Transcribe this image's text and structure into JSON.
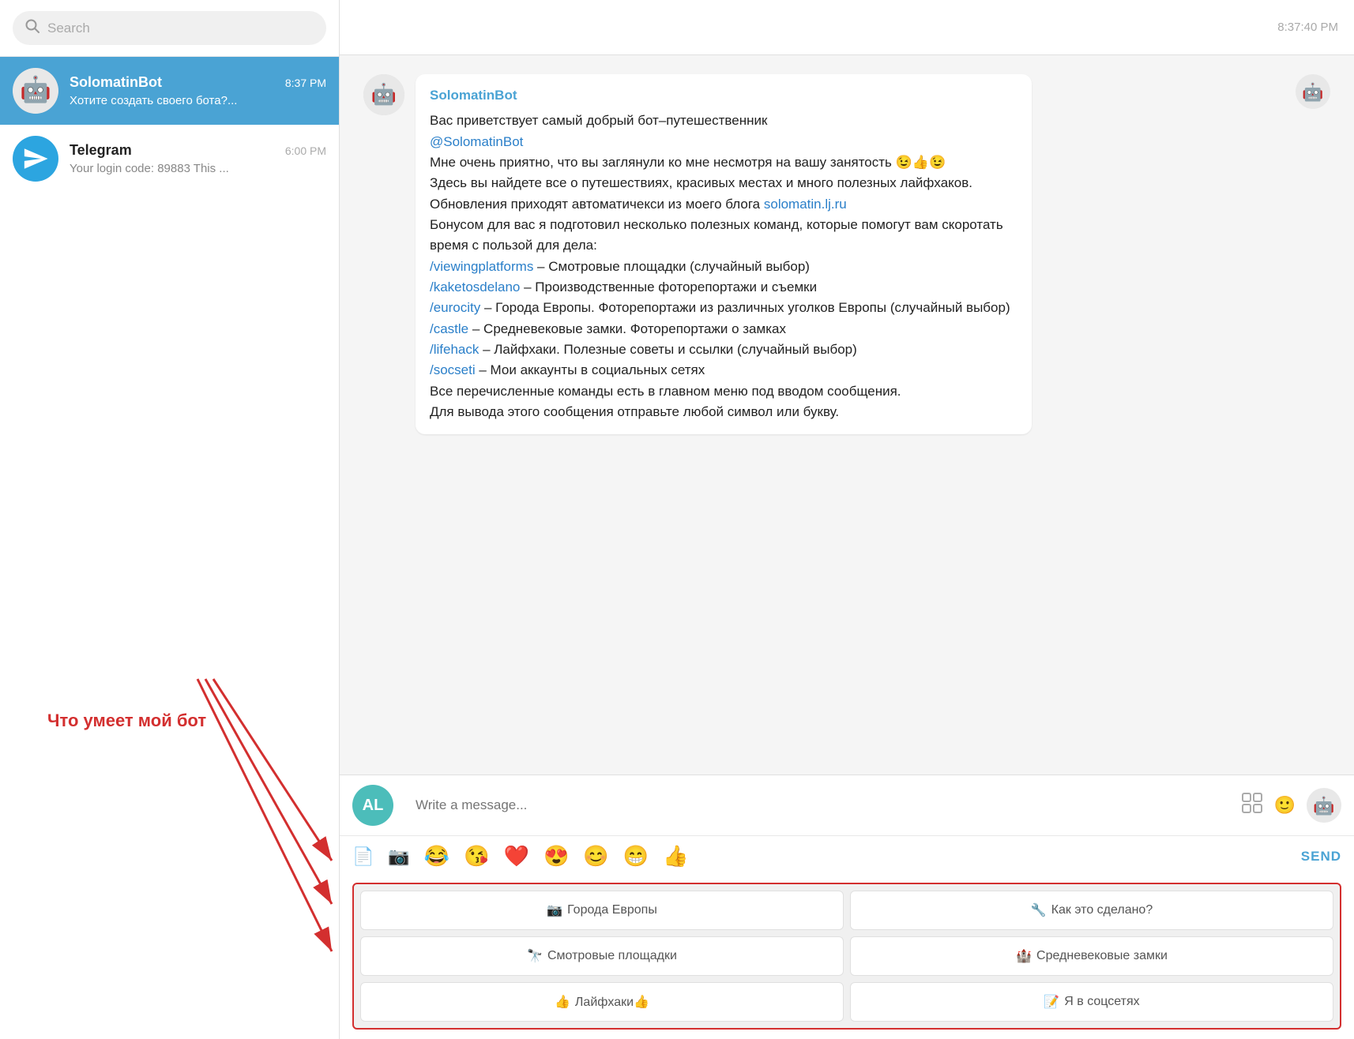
{
  "sidebar": {
    "search_placeholder": "Search",
    "chats": [
      {
        "id": "solomatin-bot",
        "name": "SolomatinBot",
        "preview": "Хотите создать своего бота?...",
        "time": "8:37 PM",
        "active": true,
        "avatar_type": "sketch"
      },
      {
        "id": "telegram",
        "name": "Telegram",
        "preview": "Your login code: 89883 This ...",
        "time": "6:00 PM",
        "active": false,
        "avatar_type": "telegram"
      }
    ]
  },
  "annotation": {
    "text": "Что умеет мой бот"
  },
  "chat": {
    "header_time": "8:37:40 PM",
    "bot_name": "SolomatinBot",
    "message": {
      "line1": "Вас приветствует самый добрый бот–путешественник",
      "mention": "@SolomatinBot",
      "line2": "Мне очень приятно, что вы заглянули ко мне несмотря на вашу занятость 😉👍😉",
      "line3": "Здесь вы найдете все о путешествиях, красивых местах и много полезных лайфхаков. Обновления приходят автоматичекси из моего блога",
      "blog_link": "solomatin.lj.ru",
      "line4": "Бонусом для вас я подготовил несколько полезных команд, которые помогут вам скоротать время с пользой для дела:",
      "commands": [
        {
          "cmd": "/viewingplatforms",
          "desc": "– Смотровые площадки (случайный выбор)"
        },
        {
          "cmd": "/kaketosdelano",
          "desc": "– Производственные фоторепортажи и съемки"
        },
        {
          "cmd": "/eurocity",
          "desc": "– Города Европы. Фоторепортажи из различных уголков Европы (случайный выбор)"
        },
        {
          "cmd": "/castle",
          "desc": "– Средневековые замки. Фоторепортажи о замках"
        },
        {
          "cmd": "/lifehack",
          "desc": "– Лайфхаки. Полезные советы и ссылки (случайный выбор)"
        },
        {
          "cmd": "/socseti",
          "desc": "– Мои аккаунты в социальных сетях"
        }
      ],
      "line5": "Все перечисленные команды есть в главном меню под вводом сообщения.",
      "line6": "Для вывода этого сообщения отправьте любой символ или букву."
    },
    "input_placeholder": "Write a message...",
    "send_label": "SEND",
    "emoji_bar": [
      "📄",
      "📷",
      "😂",
      "😘",
      "❤️",
      "😍",
      "😊",
      "😁",
      "👍"
    ],
    "keyboard_buttons": [
      {
        "icon": "📷",
        "label": "Города Европы"
      },
      {
        "icon": "🔧",
        "label": "Как это сделано?"
      },
      {
        "icon": "🔭",
        "label": "Смотровые площадки"
      },
      {
        "icon": "🏰",
        "label": "Средневековые замки"
      },
      {
        "icon": "👍",
        "label": "Лайфхаки👍"
      },
      {
        "icon": "📝",
        "label": "Я в соцсетях"
      }
    ]
  }
}
